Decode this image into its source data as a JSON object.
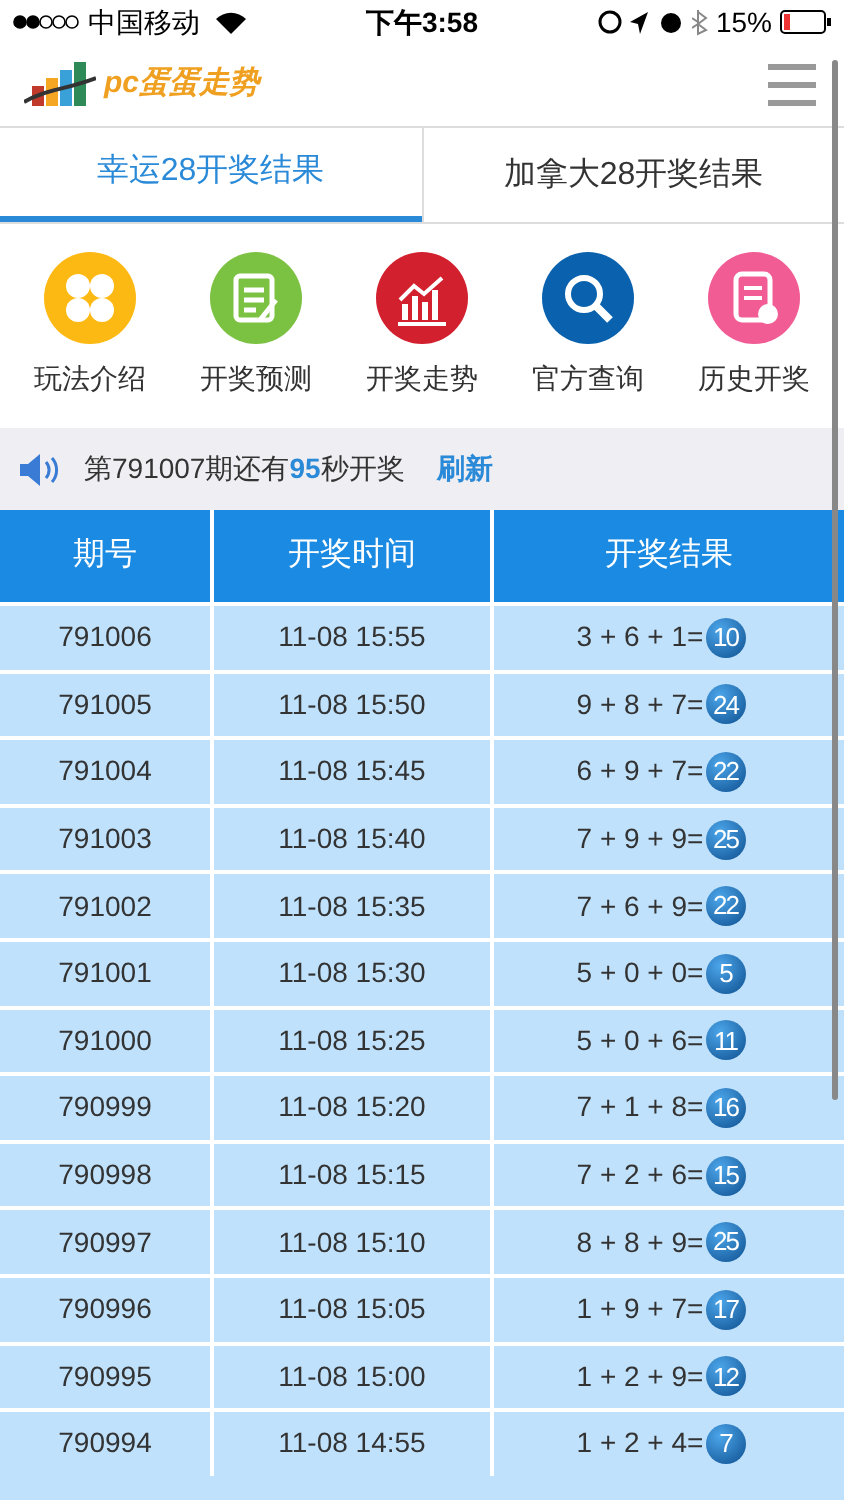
{
  "status_bar": {
    "carrier": "中国移动",
    "time": "下午3:58",
    "battery": "15%"
  },
  "header": {
    "logo_text": "pc蛋蛋走势"
  },
  "tabs": [
    {
      "label": "幸运28开奖结果",
      "selected": true
    },
    {
      "label": "加拿大28开奖结果",
      "selected": false
    }
  ],
  "shortcuts": [
    {
      "label": "玩法介绍",
      "kind": "clover",
      "color": "#fdb913"
    },
    {
      "label": "开奖预测",
      "kind": "notepad",
      "color": "#7cc242"
    },
    {
      "label": "开奖走势",
      "kind": "chart",
      "color": "#d3202f"
    },
    {
      "label": "官方查询",
      "kind": "search",
      "color": "#0a62ae"
    },
    {
      "label": "历史开奖",
      "kind": "history",
      "color": "#f25c95"
    }
  ],
  "notice": {
    "before": "第791007期还有",
    "seconds": "95",
    "after": "秒开奖",
    "refresh": "刷新"
  },
  "table": {
    "columns": [
      "期号",
      "开奖时间",
      "开奖结果"
    ],
    "rows": [
      {
        "issue": "791006",
        "time": "11-08 15:55",
        "formula": "3 + 6 + 1=",
        "sum": "10"
      },
      {
        "issue": "791005",
        "time": "11-08 15:50",
        "formula": "9 + 8 + 7=",
        "sum": "24"
      },
      {
        "issue": "791004",
        "time": "11-08 15:45",
        "formula": "6 + 9 + 7=",
        "sum": "22"
      },
      {
        "issue": "791003",
        "time": "11-08 15:40",
        "formula": "7 + 9 + 9=",
        "sum": "25"
      },
      {
        "issue": "791002",
        "time": "11-08 15:35",
        "formula": "7 + 6 + 9=",
        "sum": "22"
      },
      {
        "issue": "791001",
        "time": "11-08 15:30",
        "formula": "5 + 0 + 0=",
        "sum": "5"
      },
      {
        "issue": "791000",
        "time": "11-08 15:25",
        "formula": "5 + 0 + 6=",
        "sum": "11"
      },
      {
        "issue": "790999",
        "time": "11-08 15:20",
        "formula": "7 + 1 + 8=",
        "sum": "16"
      },
      {
        "issue": "790998",
        "time": "11-08 15:15",
        "formula": "7 + 2 + 6=",
        "sum": "15"
      },
      {
        "issue": "790997",
        "time": "11-08 15:10",
        "formula": "8 + 8 + 9=",
        "sum": "25"
      },
      {
        "issue": "790996",
        "time": "11-08 15:05",
        "formula": "1 + 9 + 7=",
        "sum": "17"
      },
      {
        "issue": "790995",
        "time": "11-08 15:00",
        "formula": "1 + 2 + 9=",
        "sum": "12"
      },
      {
        "issue": "790994",
        "time": "11-08 14:55",
        "formula": "1 + 2 + 4=",
        "sum": "7"
      }
    ]
  }
}
